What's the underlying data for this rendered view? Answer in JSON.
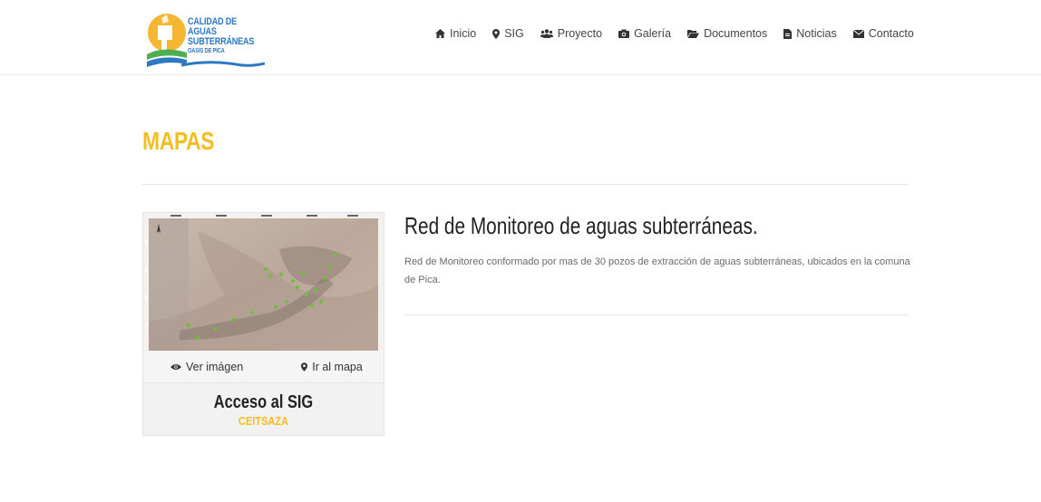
{
  "logo": {
    "line1": "CALIDAD DE AGUAS",
    "line2": "SUBTERRÁNEAS",
    "line3": "OASIS DE PICA"
  },
  "nav": {
    "items": [
      {
        "label": "Inicio",
        "icon": "home-icon"
      },
      {
        "label": "SIG",
        "icon": "map-marker-icon"
      },
      {
        "label": "Proyecto",
        "icon": "users-icon"
      },
      {
        "label": "Galería",
        "icon": "camera-icon"
      },
      {
        "label": "Documentos",
        "icon": "folder-open-icon"
      },
      {
        "label": "Noticias",
        "icon": "file-icon"
      },
      {
        "label": "Contacto",
        "icon": "envelope-icon"
      }
    ]
  },
  "page": {
    "title": "MAPAS"
  },
  "card": {
    "view_image": "Ver imágen",
    "go_to_map": "Ir al mapa",
    "title": "Acceso al SIG",
    "subtitle": "CEITSAZA"
  },
  "item": {
    "title": "Red de Monitoreo de aguas subterráneas.",
    "description": "Red de Monitoreo conformado por mas de 30 pozos de extracción de aguas subterráneas, ubicados en la comuna de Pica."
  },
  "colors": {
    "accent": "#f5bd1f",
    "logo_blue": "#2c78c3",
    "logo_green": "#4caf50"
  }
}
